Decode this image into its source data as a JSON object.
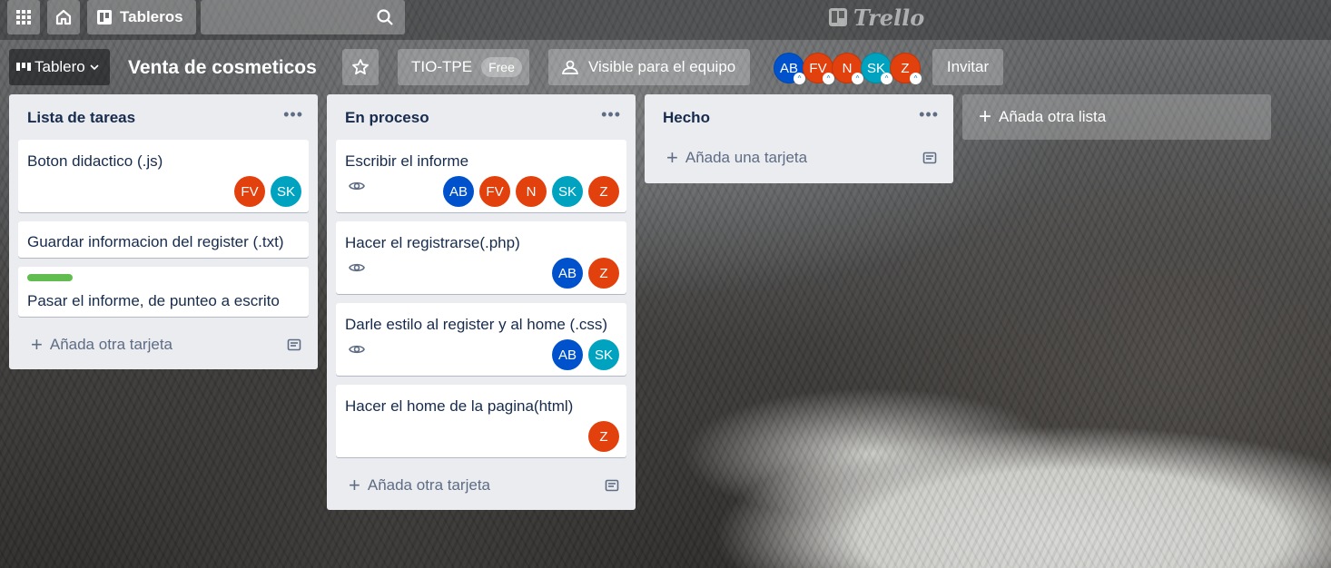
{
  "colors": {
    "avatar_AB": "#0052cc",
    "avatar_FV": "#e2400d",
    "avatar_N": "#e2400d",
    "avatar_SK": "#00a3bf",
    "avatar_Z": "#e2400d",
    "label_green": "#61bd4f"
  },
  "topbar": {
    "apps_icon": "grid-icon",
    "home_icon": "home-icon",
    "boards_label": "Tableros",
    "search_icon": "search-icon",
    "logo_text": "Trello"
  },
  "board_header": {
    "switcher_label": "Tablero",
    "title": "Venta de cosmeticos",
    "team_label": "TIO-TPE",
    "team_badge": "Free",
    "visibility_label": "Visible para el equipo",
    "members": [
      "AB",
      "FV",
      "N",
      "SK",
      "Z"
    ],
    "invite_label": "Invitar"
  },
  "lists": [
    {
      "title": "Lista de tareas",
      "cards": [
        {
          "title": "Boton didactico (.js)",
          "members": [
            "FV",
            "SK"
          ]
        },
        {
          "title": "Guardar informacion del register (.txt)",
          "members": []
        },
        {
          "title": "Pasar el informe, de punteo a escrito",
          "members": [],
          "label": "green"
        }
      ],
      "add_label": "Añada otra tarjeta"
    },
    {
      "title": "En proceso",
      "cards": [
        {
          "title": "Escribir el informe",
          "members": [
            "AB",
            "FV",
            "N",
            "SK",
            "Z"
          ],
          "watching": true
        },
        {
          "title": "Hacer el registrarse(.php)",
          "members": [
            "AB",
            "Z"
          ],
          "watching": true
        },
        {
          "title": "Darle estilo al register y al home (.css)",
          "members": [
            "AB",
            "SK"
          ],
          "watching": true
        },
        {
          "title": "Hacer el home de la pagina(html)",
          "members": [
            "Z"
          ]
        }
      ],
      "add_label": "Añada otra tarjeta"
    },
    {
      "title": "Hecho",
      "cards": [],
      "add_label": "Añada una tarjeta"
    }
  ],
  "add_list_label": "Añada otra lista"
}
